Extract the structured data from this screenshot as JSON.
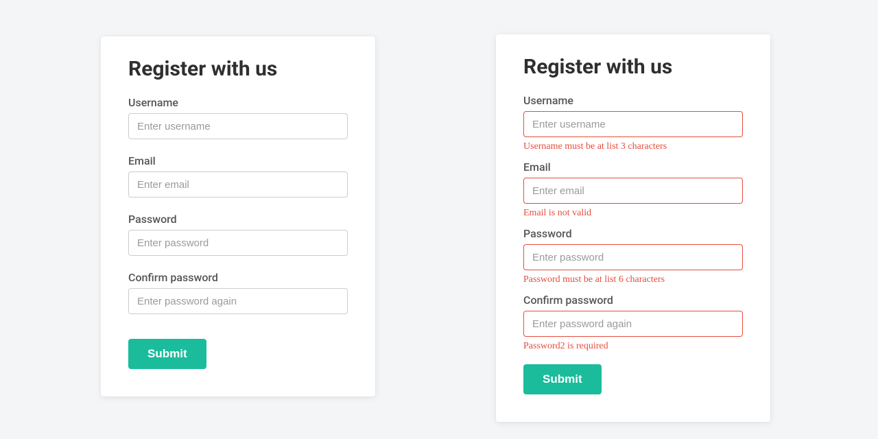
{
  "left": {
    "title": "Register with us",
    "fields": {
      "username": {
        "label": "Username",
        "placeholder": "Enter username"
      },
      "email": {
        "label": "Email",
        "placeholder": "Enter email"
      },
      "password": {
        "label": "Password",
        "placeholder": "Enter password"
      },
      "confirm": {
        "label": "Confirm password",
        "placeholder": "Enter password again"
      }
    },
    "submit_label": "Submit"
  },
  "right": {
    "title": "Register with us",
    "fields": {
      "username": {
        "label": "Username",
        "placeholder": "Enter username",
        "error": "Username must be at list 3 characters"
      },
      "email": {
        "label": "Email",
        "placeholder": "Enter email",
        "error": "Email is not valid"
      },
      "password": {
        "label": "Password",
        "placeholder": "Enter password",
        "error": "Password must be at list 6 characters"
      },
      "confirm": {
        "label": "Confirm password",
        "placeholder": "Enter password again",
        "error": "Password2 is required"
      }
    },
    "submit_label": "Submit"
  }
}
